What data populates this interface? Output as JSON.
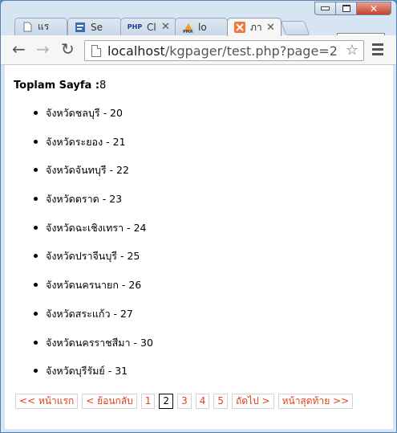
{
  "tabs": [
    {
      "label": "แร",
      "icon": "page-icon"
    },
    {
      "label": "Se",
      "icon": "script-icon"
    },
    {
      "label": "Cl",
      "icon": "php-icon",
      "closable": true
    },
    {
      "label": "lo",
      "icon": "phpmyadmin-icon",
      "closable": true
    },
    {
      "label": "ภา",
      "icon": "xampp-icon",
      "closable": true,
      "active": true
    }
  ],
  "toolbar": {
    "url_host": "localhost",
    "url_path": "/kgpager/test.php?page=2"
  },
  "page": {
    "total_label": "Toplam Sayfa :",
    "total_value": "8",
    "items": [
      "จังหวัดชลบุรี - 20",
      "จังหวัดระยอง - 21",
      "จังหวัดจันทบุรี - 22",
      "จังหวัดตราด - 23",
      "จังหวัดฉะเชิงเทรา - 24",
      "จังหวัดปราจีนบุรี - 25",
      "จังหวัดนครนายก - 26",
      "จังหวัดสระแก้ว - 27",
      "จังหวัดนครราชสีมา - 30",
      "จังหวัดบุรีรัมย์ - 31"
    ]
  },
  "pager": {
    "first": "<< หน้าแรก",
    "prev": "< ย้อนกลับ",
    "pages": [
      "1",
      "2",
      "3",
      "4",
      "5"
    ],
    "current": "2",
    "next": "ถัดไป >",
    "last": "หน้าสุดท้าย >>"
  },
  "colors": {
    "link": "#e0401e",
    "titlebar": "#d6e4f3"
  }
}
